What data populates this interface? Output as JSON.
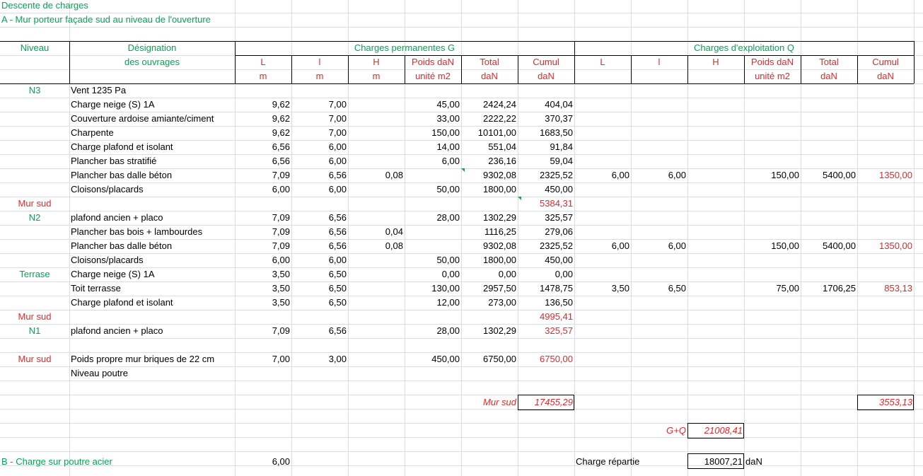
{
  "title": "Descente de charges",
  "subtitle": "A - Mur porteur façade sud au niveau de l'ouverture",
  "header": {
    "niveau": "Niveau",
    "designation_1": "Désignation",
    "designation_2": "des ouvrages",
    "group_g": "Charges permanentes G",
    "group_q": "Charges d'exploitation Q",
    "g_cols": [
      {
        "top": "L",
        "bottom": "m"
      },
      {
        "top": "l",
        "bottom": "m"
      },
      {
        "top": "H",
        "bottom": "m"
      },
      {
        "top": "Poids daN",
        "bottom": "unité m2"
      },
      {
        "top": "Total",
        "bottom": "daN"
      },
      {
        "top": "Cumul",
        "bottom": "daN"
      }
    ],
    "q_cols": [
      {
        "top": "L",
        "bottom": ""
      },
      {
        "top": "l",
        "bottom": ""
      },
      {
        "top": "H",
        "bottom": ""
      },
      {
        "top": "Poids daN",
        "bottom": "unité m2"
      },
      {
        "top": "Total",
        "bottom": "daN"
      },
      {
        "top": "Cumul",
        "bottom": "daN"
      }
    ]
  },
  "rows": [
    {
      "niveau": "N3",
      "niveau_color": "green",
      "designation": "Vent 1235 Pa"
    },
    {
      "designation": "Charge neige (S) 1A",
      "gL": "9,62",
      "gl": "7,00",
      "gPoids": "45,00",
      "gTotal": "2424,24",
      "gCumul": "404,04"
    },
    {
      "designation": "Couverture ardoise amiante/ciment",
      "gL": "9,62",
      "gl": "7,00",
      "gPoids": "33,00",
      "gTotal": "2222,22",
      "gCumul": "370,37"
    },
    {
      "designation": "Charpente",
      "gL": "9,62",
      "gl": "7,00",
      "gPoids": "150,00",
      "gTotal": "10101,00",
      "gCumul": "1683,50"
    },
    {
      "designation": "Charge plafond et isolant",
      "gL": "6,56",
      "gl": "6,00",
      "gPoids": "14,00",
      "gTotal": "551,04",
      "gCumul": "91,84"
    },
    {
      "designation": "Plancher bas stratifié",
      "gL": "6,56",
      "gl": "6,00",
      "gPoids": "6,00",
      "gTotal": "236,16",
      "gCumul": "59,04"
    },
    {
      "designation": "Plancher bas dalle béton",
      "gL": "7,09",
      "gl": "6,56",
      "gH": "0,08",
      "gTotal": "9302,08",
      "gCumul": "2325,52",
      "qL": "6,00",
      "ql": "6,00",
      "qPoids": "150,00",
      "qTotal": "5400,00",
      "qCumul": "1350,00"
    },
    {
      "designation": "Cloisons/placards",
      "gL": "6,00",
      "gl": "6,00",
      "gPoids": "50,00",
      "gTotal": "1800,00",
      "gCumul": "450,00"
    },
    {
      "niveau": "Mur sud",
      "niveau_color": "red",
      "gCumul": "5384,31",
      "gCumul_color": "red"
    },
    {
      "niveau": "N2",
      "niveau_color": "green",
      "designation": "plafond ancien + placo",
      "gL": "7,09",
      "gl": "6,56",
      "gPoids": "28,00",
      "gTotal": "1302,29",
      "gCumul": "325,57"
    },
    {
      "designation": "Plancher bas bois + lambourdes",
      "gL": "7,09",
      "gl": "6,56",
      "gH": "0,04",
      "gTotal": "1116,25",
      "gCumul": "279,06"
    },
    {
      "designation": "Plancher bas dalle béton",
      "gL": "7,09",
      "gl": "6,56",
      "gH": "0,08",
      "gTotal": "9302,08",
      "gCumul": "2325,52",
      "qL": "6,00",
      "ql": "6,00",
      "qPoids": "150,00",
      "qTotal": "5400,00",
      "qCumul": "1350,00"
    },
    {
      "designation": "Cloisons/placards",
      "gL": "6,00",
      "gl": "6,00",
      "gPoids": "50,00",
      "gTotal": "1800,00",
      "gCumul": "450,00"
    },
    {
      "niveau": "Terrase",
      "niveau_color": "green",
      "designation": "Charge neige (S) 1A",
      "gL": "3,50",
      "gl": "6,50",
      "gPoids": "0,00",
      "gTotal": "0,00",
      "gCumul": "0,00"
    },
    {
      "designation": "Toit terrasse",
      "gL": "3,50",
      "gl": "6,50",
      "gPoids": "130,00",
      "gTotal": "2957,50",
      "gCumul": "1478,75",
      "qL": "3,50",
      "ql": "6,50",
      "qPoids": "75,00",
      "qTotal": "1706,25",
      "qCumul": "853,13"
    },
    {
      "designation": "Charge plafond et isolant",
      "gL": "3,50",
      "gl": "6,50",
      "gPoids": "12,00",
      "gTotal": "273,00",
      "gCumul": "136,50"
    },
    {
      "niveau": "Mur sud",
      "niveau_color": "red",
      "gCumul": "4995,41",
      "gCumul_color": "red"
    },
    {
      "niveau": "N1",
      "niveau_color": "green",
      "designation": "plafond ancien + placo",
      "gL": "7,09",
      "gl": "6,56",
      "gPoids": "28,00",
      "gTotal": "1302,29",
      "gCumul": "325,57",
      "gCumul_color": "red"
    },
    {},
    {
      "niveau": "Mur sud",
      "niveau_color": "red",
      "designation": "Poids propre mur briques de 22 cm",
      "gL": "7,00",
      "gl": "3,00",
      "gPoids": "450,00",
      "gTotal": "6750,00",
      "gCumul": "6750,00",
      "gCumul_color": "red"
    },
    {
      "designation": "Niveau poutre"
    }
  ],
  "totals": {
    "mur_sud_label": "Mur sud",
    "g_total": "17455,29",
    "q_total": "3553,13",
    "gq_label": "G+Q",
    "gq_total": "21008,41"
  },
  "section_b": {
    "label": "B - Charge sur poutre acier",
    "value": "6,00",
    "charge_label": "Charge répartie",
    "charge_value": "18007,21",
    "unit": "daN"
  }
}
